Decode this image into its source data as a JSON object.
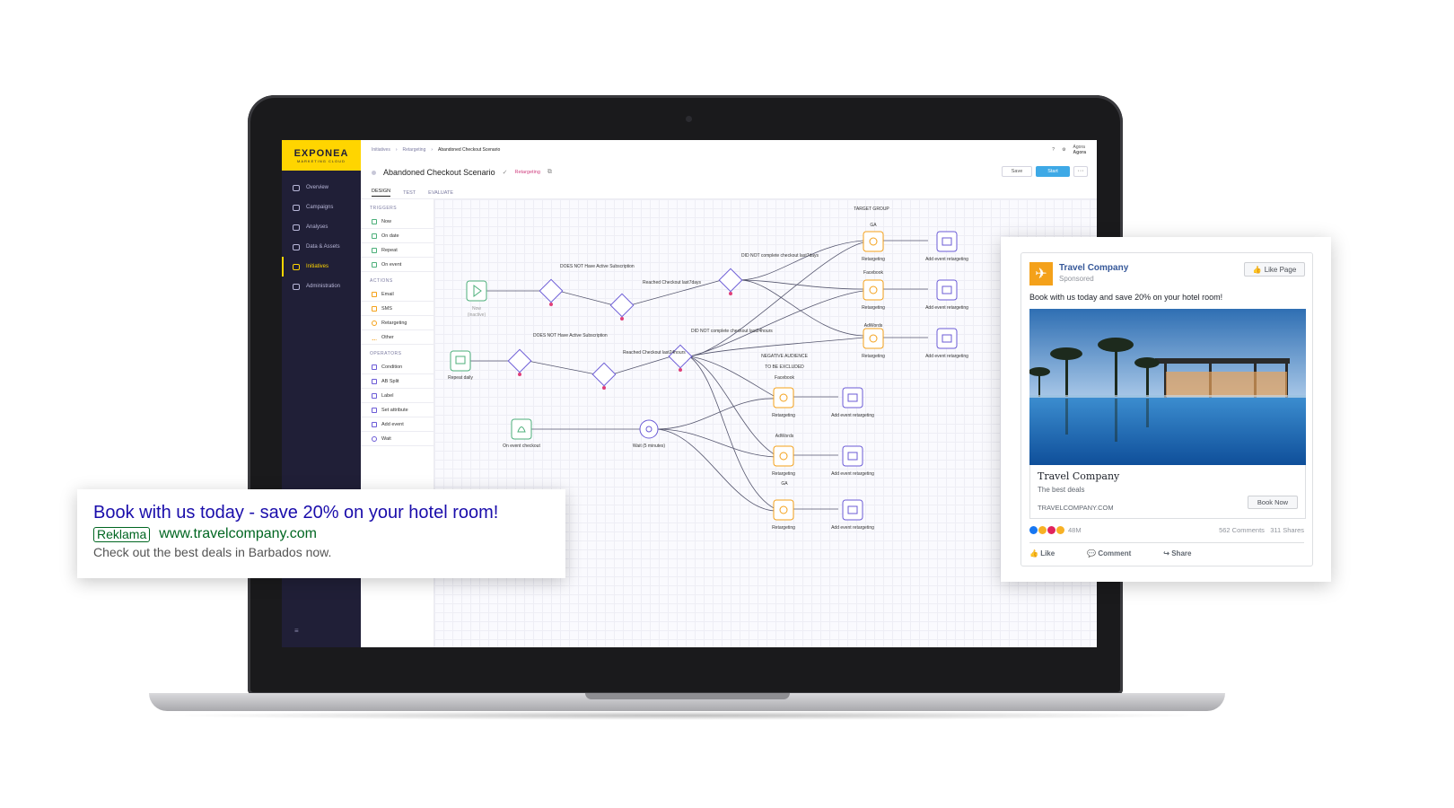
{
  "app": {
    "logo": "EXPONEA",
    "logo_sub": "MARKETING CLOUD",
    "nav": [
      "Overview",
      "Campaigns",
      "Analyses",
      "Data & Assets",
      "Initiatives",
      "Administration"
    ],
    "breadcrumb": [
      "Initiatives",
      "Retargeting",
      "Abandoned Checkout Scenario"
    ],
    "user": {
      "line1": "Agora",
      "line2": "Agora"
    },
    "title": "Abandoned Checkout Scenario",
    "tag": "Retargeting",
    "save_label": "Save",
    "start_label": "Start",
    "tabs": [
      "DESIGN",
      "TEST",
      "EVALUATE"
    ],
    "palette": {
      "triggers_head": "TRIGGERS",
      "triggers": [
        "Now",
        "On date",
        "Repeat",
        "On event"
      ],
      "actions_head": "ACTIONS",
      "actions": [
        "Email",
        "SMS",
        "Retargeting",
        "Other"
      ],
      "operators_head": "OPERATORS",
      "operators": [
        "Condition",
        "AB Split",
        "Label",
        "Set attribute",
        "Add event",
        "Wait"
      ]
    },
    "flow": {
      "target_group": "TARGET GROUP",
      "negative_1": "NEGATIVE AUDIENCE",
      "negative_2": "TO BE EXCLUDED",
      "now_label": "Now",
      "inactive": "(inactive)",
      "repeat_label": "Repeat daily",
      "event_label": "On event checkout",
      "wait_label": "Wait (5 minutes)",
      "c1": "DOES NOT Have Active Subscription",
      "c2": "Reached Checkout last7days",
      "c3": "DID NOT complete checkout last7days",
      "c4": "DOES NOT Have Active Subscription",
      "c5": "Reached Checkout last24hours",
      "c6": "DID NOT complete checkout last24hours",
      "ga": "GA",
      "facebook": "Facebook",
      "adwords": "AdWords",
      "retargeting": "Retargeting",
      "add_event": "Add event retargeting"
    }
  },
  "google_ad": {
    "headline": "Book with us today - save 20% on your hotel room!",
    "badge": "Reklama",
    "url": "www.travelcompany.com",
    "description": "Check out the best deals in Barbados now."
  },
  "facebook_ad": {
    "page_name": "Travel Company",
    "sponsored": "Sponsored",
    "like_page": "Like Page",
    "text": "Book with us today and save 20% on your hotel room!",
    "card_title": "Travel Company",
    "card_desc": "The best deals",
    "card_url": "TRAVELCOMPANY.COM",
    "cta": "Book Now",
    "reactions": "48M",
    "comments": "562 Comments",
    "shares": "311 Shares",
    "actions": [
      "Like",
      "Comment",
      "Share"
    ]
  },
  "colors": {
    "sidebar": "#201f37",
    "brand_yellow": "#ffd500",
    "trigger_green": "#4caf7a",
    "condition_purple": "#6b5bd6",
    "retarget_orange": "#f4a11a",
    "fb_blue": "#365899",
    "google_title": "#1a0dab",
    "google_green": "#006621"
  }
}
